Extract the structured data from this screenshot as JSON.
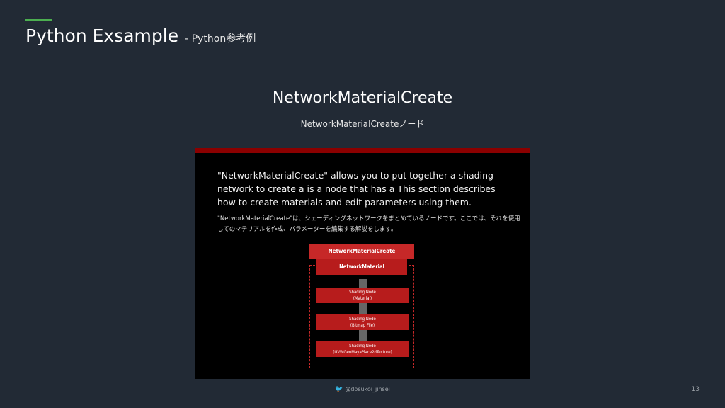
{
  "header": {
    "title": "Python Exsample",
    "subtitle": "- Python参考例"
  },
  "slide": {
    "heading": "NetworkMaterialCreate",
    "subheading": "NetworkMaterialCreateノード"
  },
  "doc": {
    "english": "\"NetworkMaterialCreate\" allows you to put together a shading network to create a is a node that has a This section describes how to create materials and edit parameters using them.",
    "japanese": "\"NetworkMaterialCreate\"は、シェーディングネットワークをまとめているノードです。ここでは、それを使用してのマテリアルを作成、パラメーターを編集する解説をします。",
    "diagram": {
      "root": "NetworkMaterialCreate",
      "material": "NetworkMaterial",
      "nodes": [
        {
          "line1": "Shading Node",
          "line2": "(Material)"
        },
        {
          "line1": "Shading Node",
          "line2": "(Bitmap File)"
        },
        {
          "line1": "Shading Node",
          "line2": "(UVWGenMayaPlace2dTexture)"
        }
      ]
    }
  },
  "footer": {
    "handle": "@dosukoi_jinsei",
    "page": "13",
    "icon": "twitter-bird-icon"
  },
  "colors": {
    "background": "#222a35",
    "accent": "#4caf50",
    "doc_bar": "#8b0000",
    "node_red": "#b71c1c"
  }
}
